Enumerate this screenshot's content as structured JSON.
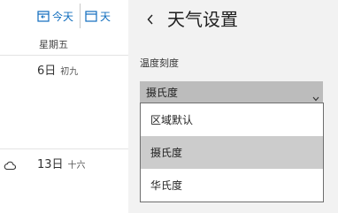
{
  "calendar": {
    "toolbar": {
      "today_label": "今天",
      "day_label": "天"
    },
    "weekday_header": "星期五",
    "days": [
      {
        "date": "6日",
        "lunar": "初九"
      },
      {
        "date": "13日",
        "lunar": "十六"
      }
    ],
    "icons": {
      "today": "calendar-today-icon",
      "day_view": "calendar-day-icon",
      "weather": "cloud-icon"
    }
  },
  "settings_panel": {
    "title": "天气设置",
    "back_icon": "chevron-left-icon",
    "temperature_scale": {
      "label": "温度刻度",
      "selected_value": "摄氏度",
      "options": [
        {
          "label": "区域默认",
          "selected": false
        },
        {
          "label": "摄氏度",
          "selected": true
        },
        {
          "label": "华氏度",
          "selected": false
        }
      ]
    }
  },
  "colors": {
    "accent": "#0f6cbd",
    "panel_background": "#f2f2f2",
    "select_background": "#bcbcbc",
    "option_selected_background": "#cccccc"
  }
}
